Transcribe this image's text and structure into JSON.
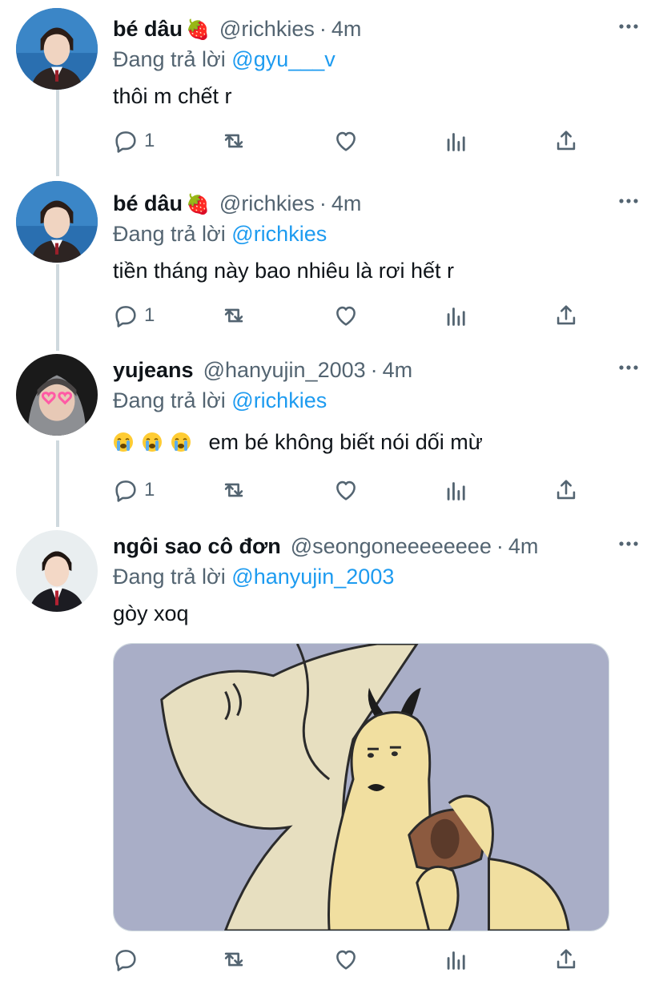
{
  "colors": {
    "link": "#1d9bf0",
    "muted": "#536471",
    "text": "#0f1419",
    "thread_line": "#cfd9de"
  },
  "tweets": [
    {
      "name": "bé dâu",
      "name_emoji": "🍓",
      "handle": "@richkies",
      "sep": "·",
      "time": "4m",
      "reply_prefix": "Đang trả lời",
      "reply_to": "@gyu___v",
      "text": "thôi m chết r",
      "reply_count": "1",
      "more_icon": "more-horizontal-icon"
    },
    {
      "name": "bé dâu",
      "name_emoji": "🍓",
      "handle": "@richkies",
      "sep": "·",
      "time": "4m",
      "reply_prefix": "Đang trả lời",
      "reply_to": "@richkies",
      "text": "tiền tháng này bao nhiêu là rơi hết r",
      "reply_count": "1",
      "more_icon": "more-horizontal-icon"
    },
    {
      "name": "yujeans",
      "handle": "@hanyujin_2003",
      "sep": "·",
      "time": "4m",
      "reply_prefix": "Đang trả lời",
      "reply_to": "@richkies",
      "text": "em bé không biết nói dối mừ",
      "emoji_icons": [
        "loudly-crying-face-icon",
        "loudly-crying-face-icon",
        "loudly-crying-face-icon"
      ],
      "reply_count": "1",
      "more_icon": "more-horizontal-icon"
    },
    {
      "name": "ngôi sao cô đơn",
      "handle": "@seongoneeeeeeee",
      "sep": "·",
      "time": "4m",
      "reply_prefix": "Đang trả lời",
      "reply_to": "@hanyujin_2003",
      "text": "gòy xoq",
      "reply_count": "",
      "has_media": true,
      "more_icon": "more-horizontal-icon"
    }
  ],
  "action_icons": [
    "reply-icon",
    "retweet-icon",
    "like-icon",
    "analytics-icon",
    "share-icon"
  ]
}
